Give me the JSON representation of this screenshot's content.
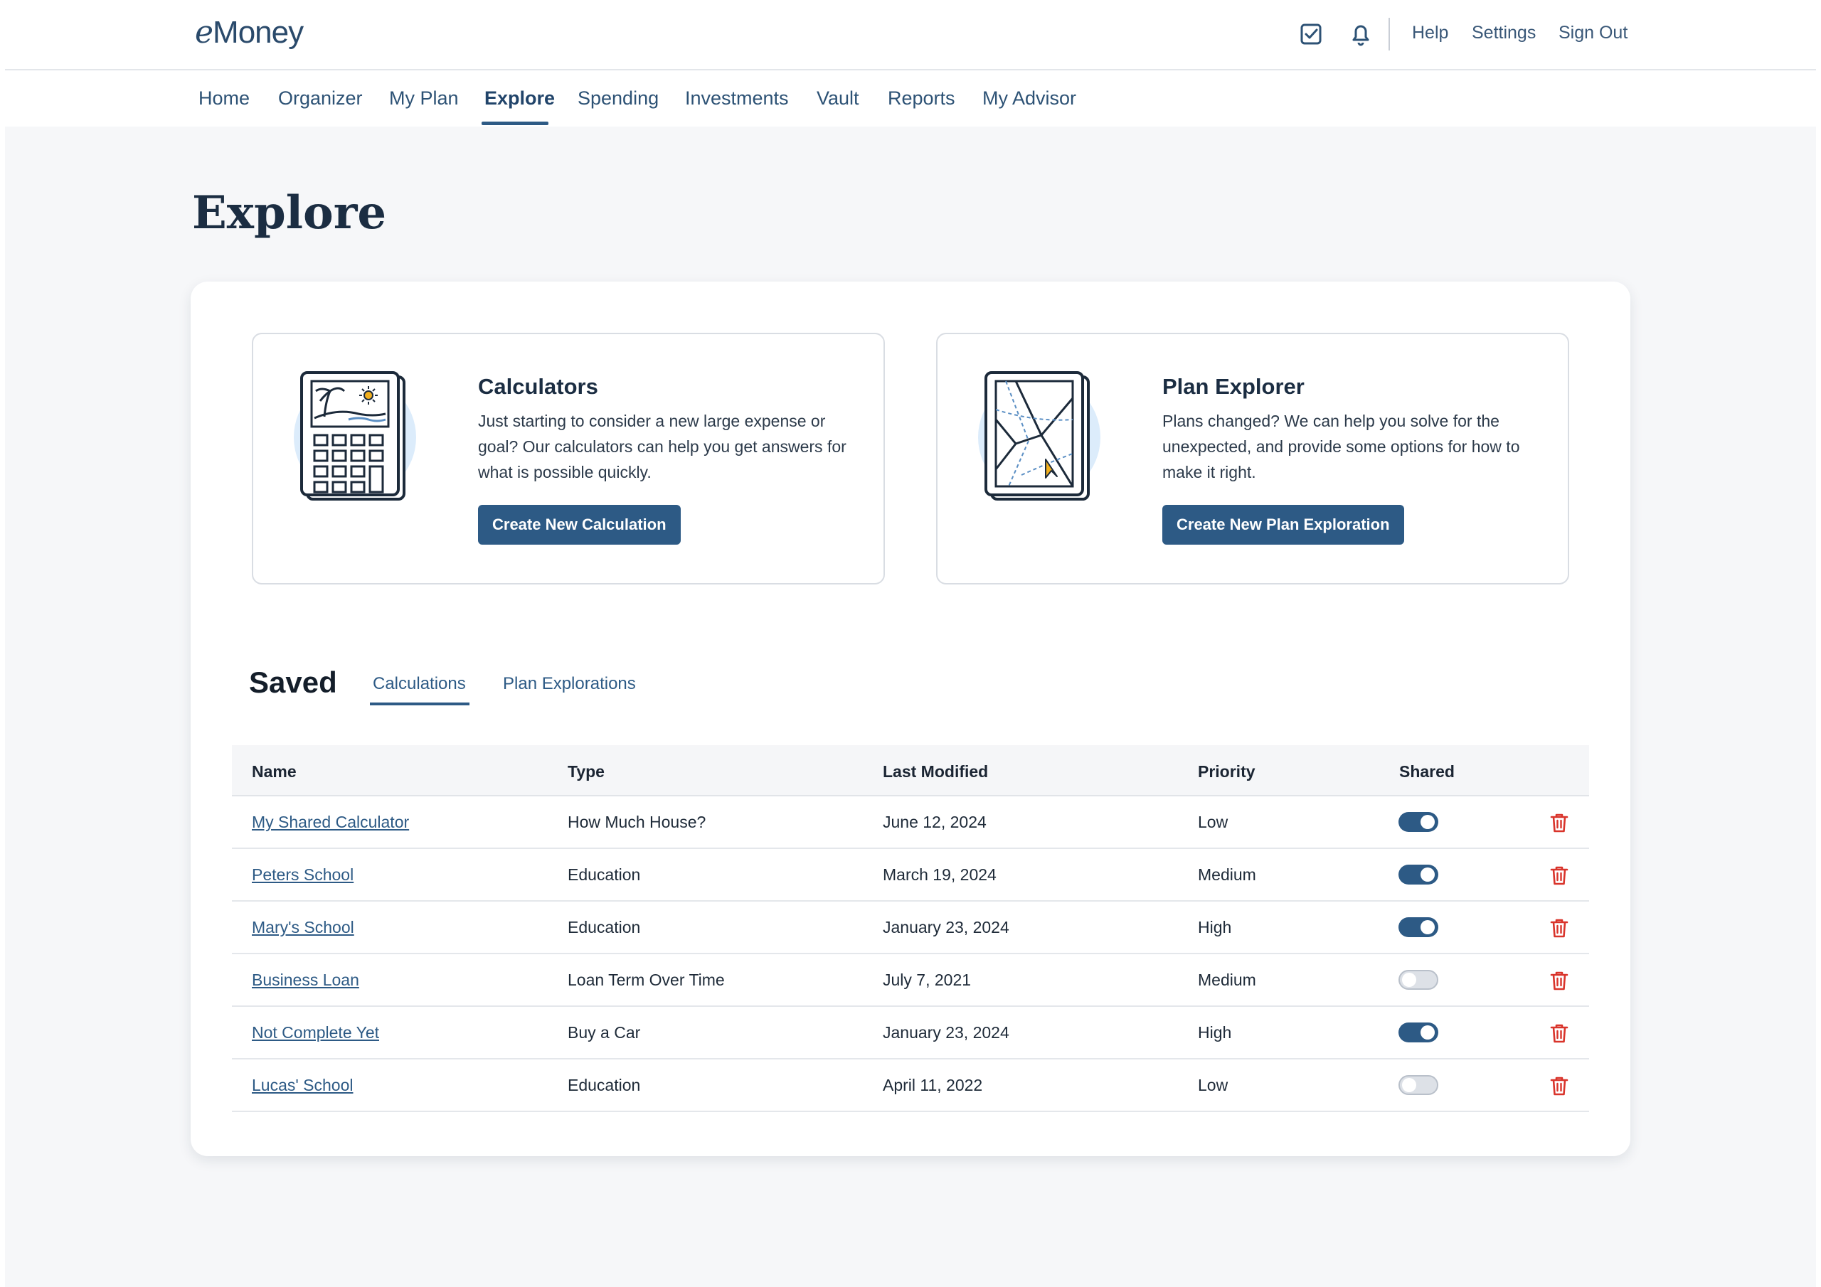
{
  "header": {
    "logo_prefix": "e",
    "logo_rest": "Money",
    "icons": [
      "tasks-check-icon",
      "bell-icon"
    ],
    "links": [
      "Help",
      "Settings",
      "Sign Out"
    ]
  },
  "nav": {
    "items": [
      "Home",
      "Organizer",
      "My Plan",
      "Explore",
      "Spending",
      "Investments",
      "Vault",
      "Reports",
      "My Advisor"
    ],
    "active": "Explore"
  },
  "page": {
    "title": "Explore"
  },
  "cards": [
    {
      "title": "Calculators",
      "description": "Just starting to consider a new large expense or goal? Our calculators can help you get answers for what is possible quickly.",
      "button": "Create New Calculation",
      "icon": "calculator-icon"
    },
    {
      "title": "Plan Explorer",
      "description": "Plans changed? We can help you solve for the unexpected, and provide some options for how to make it right.",
      "button": "Create New Plan Exploration",
      "icon": "map-icon"
    }
  ],
  "saved": {
    "title": "Saved",
    "tabs": [
      "Calculations",
      "Plan Explorations"
    ],
    "active_tab": "Calculations"
  },
  "table": {
    "columns": [
      "Name",
      "Type",
      "Last Modified",
      "Priority",
      "Shared"
    ],
    "rows": [
      {
        "name": "My Shared Calculator",
        "type": "How Much House?",
        "modified": "June 12, 2024",
        "priority": "Low",
        "shared": true
      },
      {
        "name": "Peters School",
        "type": "Education",
        "modified": "March 19, 2024",
        "priority": "Medium",
        "shared": true
      },
      {
        "name": "Mary's School",
        "type": "Education",
        "modified": "January 23, 2024",
        "priority": "High",
        "shared": true
      },
      {
        "name": "Business Loan",
        "type": "Loan Term Over Time",
        "modified": "July 7, 2021",
        "priority": "Medium",
        "shared": false
      },
      {
        "name": "Not Complete Yet",
        "type": "Buy a Car",
        "modified": "January 23, 2024",
        "priority": "High",
        "shared": true
      },
      {
        "name": "Lucas' School",
        "type": "Education",
        "modified": "April 11, 2022",
        "priority": "Low",
        "shared": false
      }
    ]
  },
  "colors": {
    "accent": "#2d5a85",
    "text": "#1b2d42",
    "danger": "#d9342b",
    "background": "#f6f7f9"
  }
}
